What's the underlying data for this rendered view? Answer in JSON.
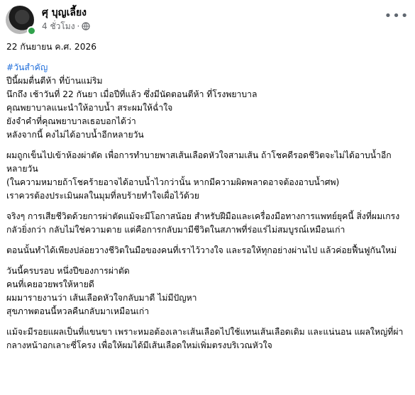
{
  "post": {
    "author": "ศุ บุญเลี้ยง",
    "time": "4 ชั่วโมง",
    "separator": "·",
    "privacy_icon": "globe-icon",
    "more_icon": "more-options-icon",
    "more_label": "•••"
  },
  "body": {
    "date": "22 กันยายน ค.ศ. 2026",
    "hashtag": "#วันสำคัญ",
    "p1": [
      "ปีนี้ผมตื่นตีห้า ที่บ้านแม่ริม",
      "นึกถึง เช้าวันที่ 22 กันยา เมื่อปีที่แล้ว ซึ่งมีนัดตอนตีห้า ที่โรงพยาบาล",
      "คุณพยาบาลแนะนำให้อาบน้ำ สระผมให้ฉ่ำใจ",
      "ยังจำคำที่คุณพยาบาลเธอบอกได้ว่า",
      "หลังจากนี้ คงไม่ได้อาบน้ำอีกหลายวัน"
    ],
    "p2": [
      "ผมถูกเข็นไปเข้าห้องผ่าตัด เพื่อการทำบายพาสเส้นเลือดหัวใจสามเส้น ถ้าโชคดีรอดชีวิตจะไม่ได้อาบน้ำอีกหลายวัน",
      "(ในความหมายถ้าโชคร้ายอาจได้อาบน้ำไวกว่านั้น หากมีความผิดพลาดอาจต้องอาบน้ำศพ)",
      "เราควรต้องประเมินผลในมุมที่ลบร้ายทำใจเผื่อไว้ด้วย"
    ],
    "p3": "จริงๆ การเสียชีวิตด้วยการผ่าตัดแม้จะมีโอกาสน้อย สำหรับฝีมือและเครื่องมือทางการแพทย์ยุคนี้ สิ่งที่ผมเกรงกลัวยิ่งกว่า กลับไม่ใช่ความตาย แต่คือการกลับมามีชีวิตในสภาพที่ร่อแร่ไม่สมบูรณ์เหมือนเก่า",
    "p4": "ตอนนั้นทำได้เพียงปล่อยวางชีวิตในมือของคนที่เราไว้วางใจ และรอให้ทุกอย่างผ่านไป แล้วค่อยฟื้นฟูกันใหม่",
    "p5": [
      "วันนี้ครบรอบ หนึ่งปีของการผ่าตัด",
      "คนที่เคยอวยพรให้หายดี",
      "ผมมารายงานว่า เส้นเลือดหัวใจกลับมาดี ไม่มีปัญหา",
      "สุขภาพตอนนี้หวลคืนกลับมาเหมือนเก่า"
    ],
    "p6": "แม้จะมีรอยแผลเป็นที่แขนขา เพราะหมอต้องเลาะเส้นเลือดไปใช้แทนเส้นเลือดเดิม และแน่นอน แผลใหญ่ที่ผ่ากลางหน้าอกเลาะซี่โครง เพื่อให้ผมได้มีเส้นเลือดใหม่เพิ่มตรงบริเวณหัวใจ"
  },
  "colors": {
    "hashtag": "#216fdb",
    "meta": "#65676b",
    "online": "#31a24c"
  }
}
